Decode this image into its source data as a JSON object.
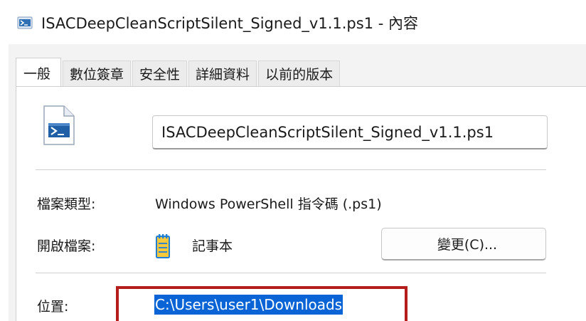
{
  "window": {
    "title": "ISACDeepCleanScriptSilent_Signed_v1.1.ps1 - 內容"
  },
  "tabs": [
    {
      "label": "一般",
      "active": true
    },
    {
      "label": "數位簽章",
      "active": false
    },
    {
      "label": "安全性",
      "active": false
    },
    {
      "label": "詳細資料",
      "active": false
    },
    {
      "label": "以前的版本",
      "active": false
    }
  ],
  "general": {
    "file_name": "ISACDeepCleanScriptSilent_Signed_v1.1.ps1",
    "file_type_label": "檔案類型:",
    "file_type_value": "Windows PowerShell 指令碼 (.ps1)",
    "opens_with_label": "開啟檔案:",
    "opens_with_value": "記事本",
    "change_button_label": "變更(C)...",
    "location_label": "位置:",
    "location_value": "C:\\Users\\user1\\Downloads"
  },
  "icons": {
    "title_icon": "powershell-file-icon",
    "file_icon": "powershell-file-icon",
    "opens_with_icon": "notepad-icon"
  },
  "colors": {
    "selection": "#0a64d6",
    "highlight_box": "#b51c1c"
  }
}
